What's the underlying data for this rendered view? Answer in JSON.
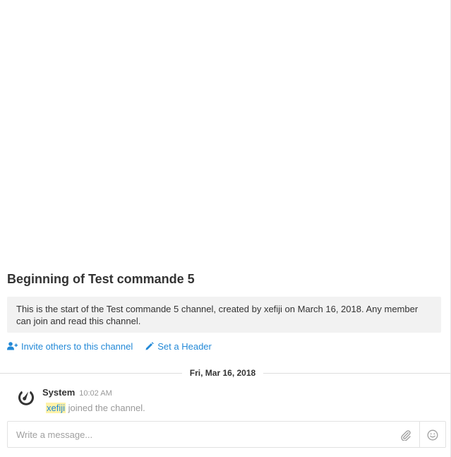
{
  "channel": {
    "title": "Beginning of Test commande 5",
    "intro": "This is the start of the Test commande 5 channel, created by xefiji on March 16, 2018. Any member can join and read this channel."
  },
  "actions": {
    "invite_label": "Invite others to this channel",
    "header_label": "Set a Header"
  },
  "date_separator": "Fri, Mar 16, 2018",
  "post": {
    "sender": "System",
    "time": "10:02 AM",
    "mention": "xefiji",
    "text": " joined the channel."
  },
  "composer": {
    "placeholder": "Write a message..."
  },
  "icons": {
    "invite": "add-user-icon",
    "header": "pencil-icon",
    "avatar": "mattermost-logo-icon",
    "attach": "paperclip-icon",
    "emoji": "smiley-icon"
  },
  "colors": {
    "link": "#2389d7",
    "mention_highlight": "#fff2a8",
    "intro_background": "#f2f2f2"
  }
}
